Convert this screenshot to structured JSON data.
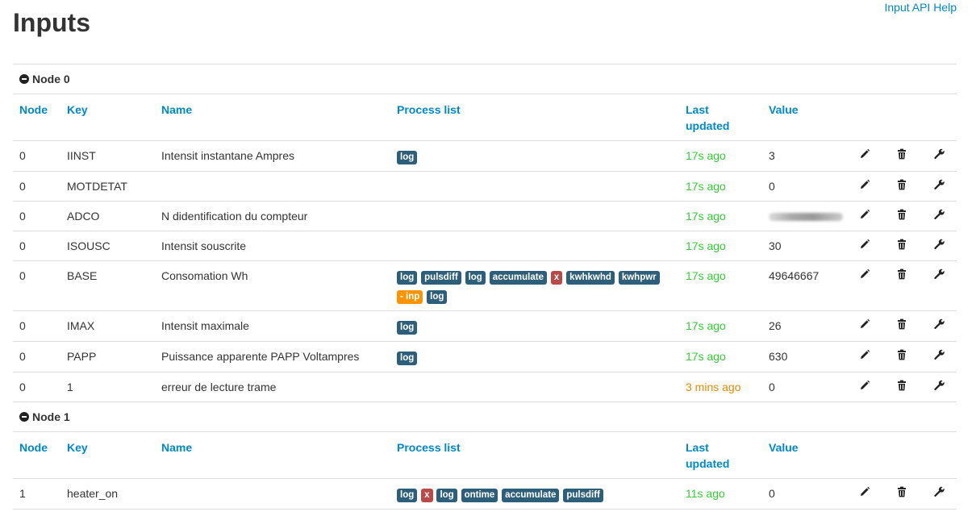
{
  "page": {
    "title": "Inputs",
    "help_link": "Input API Help"
  },
  "columns": {
    "node": "Node",
    "key": "Key",
    "name": "Name",
    "process": "Process list",
    "updated_1": "Last",
    "updated_2": "updated",
    "value": "Value"
  },
  "icons": {
    "edit": "pencil-icon",
    "delete": "trash-icon",
    "process": "wrench-icon",
    "collapse": "minus-circle-icon"
  },
  "colors": {
    "link": "#0088cc",
    "updated_recent": "#33cc33",
    "updated_stale": "#e68a00",
    "label_default": "#2e5f7a",
    "label_red": "#b94a48",
    "label_orange": "#f89406"
  },
  "groups": [
    {
      "title": "Node 0",
      "rows": [
        {
          "node": "0",
          "key": "IINST",
          "name": "Intensit instantane Ampres",
          "process": [
            {
              "t": "log",
              "c": "default"
            }
          ],
          "updated": "17s ago",
          "status": "recent",
          "value": "3"
        },
        {
          "node": "0",
          "key": "MOTDETAT",
          "name": "",
          "process": [],
          "updated": "17s ago",
          "status": "recent",
          "value": "0"
        },
        {
          "node": "0",
          "key": "ADCO",
          "name": "N didentification du compteur",
          "process": [],
          "updated": "17s ago",
          "status": "recent",
          "value": "",
          "redacted": true
        },
        {
          "node": "0",
          "key": "ISOUSC",
          "name": "Intensit souscrite",
          "process": [],
          "updated": "17s ago",
          "status": "recent",
          "value": "30"
        },
        {
          "node": "0",
          "key": "BASE",
          "name": "Consomation Wh",
          "process": [
            {
              "t": "log",
              "c": "default"
            },
            {
              "t": "pulsdiff",
              "c": "default"
            },
            {
              "t": "log",
              "c": "default"
            },
            {
              "t": "accumulate",
              "c": "default"
            },
            {
              "t": "x",
              "c": "red"
            },
            {
              "t": "kwhkwhd",
              "c": "default"
            },
            {
              "t": "kwhpwr",
              "c": "default"
            },
            {
              "t": "- inp",
              "c": "orange"
            },
            {
              "t": "log",
              "c": "default"
            }
          ],
          "updated": "17s ago",
          "status": "recent",
          "value": "49646667"
        },
        {
          "node": "0",
          "key": "IMAX",
          "name": "Intensit maximale",
          "process": [
            {
              "t": "log",
              "c": "default"
            }
          ],
          "updated": "17s ago",
          "status": "recent",
          "value": "26"
        },
        {
          "node": "0",
          "key": "PAPP",
          "name": "Puissance apparente PAPP Voltampres",
          "process": [
            {
              "t": "log",
              "c": "default"
            }
          ],
          "updated": "17s ago",
          "status": "recent",
          "value": "630"
        },
        {
          "node": "0",
          "key": "1",
          "name": "erreur de lecture trame",
          "process": [],
          "updated": "3 mins ago",
          "status": "stale",
          "value": "0"
        }
      ]
    },
    {
      "title": "Node 1",
      "rows": [
        {
          "node": "1",
          "key": "heater_on",
          "name": "",
          "process": [
            {
              "t": "log",
              "c": "default"
            },
            {
              "t": "x",
              "c": "red"
            },
            {
              "t": "log",
              "c": "default"
            },
            {
              "t": "ontime",
              "c": "default"
            },
            {
              "t": "accumulate",
              "c": "default"
            },
            {
              "t": "pulsdiff",
              "c": "default"
            }
          ],
          "updated": "11s ago",
          "status": "recent",
          "value": "0"
        }
      ]
    }
  ]
}
